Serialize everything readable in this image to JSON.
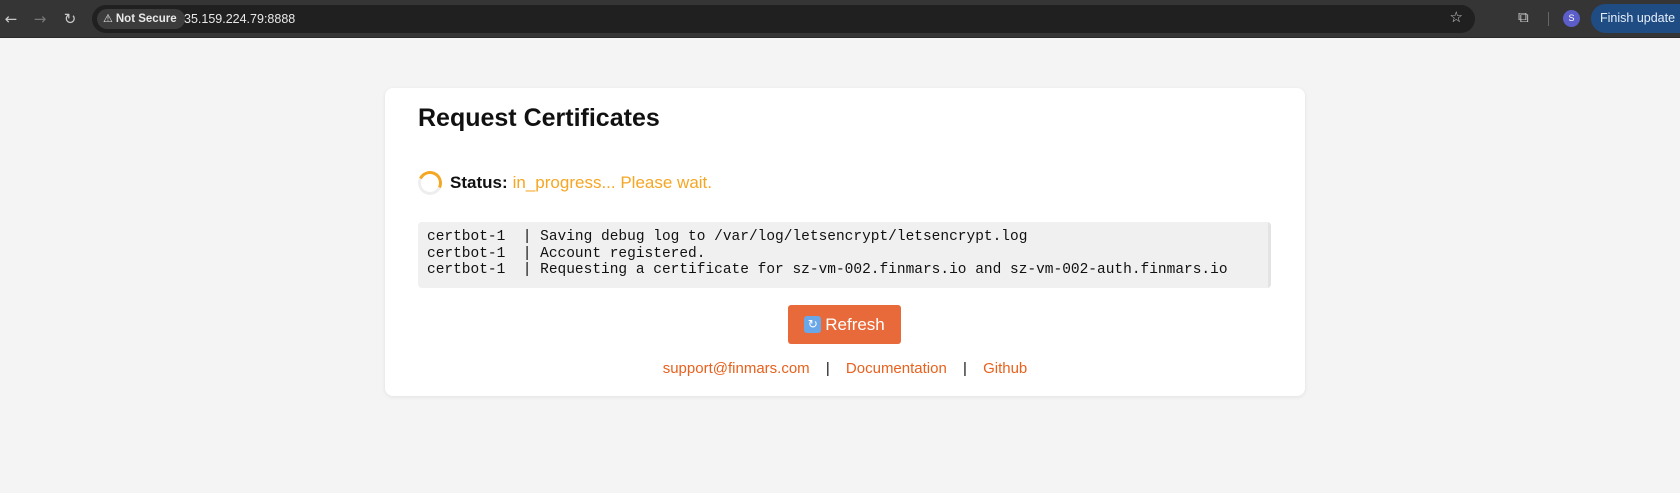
{
  "browser": {
    "not_secure_label": "Not Secure",
    "url": "35.159.224.79:8888",
    "profile_initial": "S",
    "update_label": "Finish update"
  },
  "page": {
    "title": "Request Certificates",
    "status_label": "Status:",
    "status_text": "in_progress... Please wait.",
    "status_color": "#f5a623",
    "log_lines": [
      "certbot-1  | Saving debug log to /var/log/letsencrypt/letsencrypt.log",
      "certbot-1  | Account registered.",
      "certbot-1  | Requesting a certificate for sz-vm-002.finmars.io and sz-vm-002-auth.finmars.io"
    ],
    "refresh_label": "Refresh",
    "refresh_icon": "refresh-icon",
    "accent_color": "#e86a3a"
  },
  "footer": {
    "support_link": "support@finmars.com",
    "separator": "|",
    "docs_link": "Documentation",
    "github_link": "Github"
  }
}
